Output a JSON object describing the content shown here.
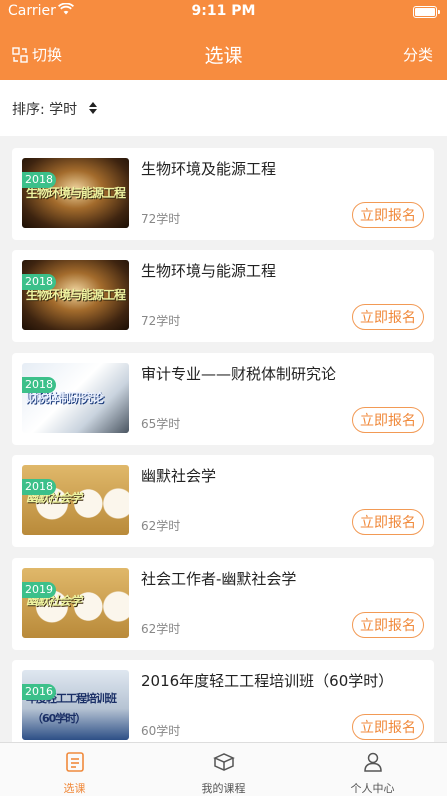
{
  "status_bar": {
    "carrier": "Carrier",
    "time": "9:11 PM"
  },
  "nav": {
    "switch_label": "切换",
    "title": "选课",
    "category_label": "分类"
  },
  "sort": {
    "label": "排序: 学时"
  },
  "colors": {
    "accent": "#f78c3f",
    "badge": "#3cc08a",
    "button_border": "#f29a55"
  },
  "courses": [
    {
      "title": "生物环境及能源工程",
      "hours": "72学时",
      "year": "2018",
      "thumb_text": "生物环境与能源工程",
      "button": "立即报名"
    },
    {
      "title": "生物环境与能源工程",
      "hours": "72学时",
      "year": "2018",
      "thumb_text": "生物环境与能源工程",
      "button": "立即报名"
    },
    {
      "title": "审计专业——财税体制研究论",
      "hours": "65学时",
      "year": "2018",
      "thumb_text": "财税体制研究论",
      "button": "立即报名"
    },
    {
      "title": "幽默社会学",
      "hours": "62学时",
      "year": "2018",
      "thumb_text": "幽默社会学",
      "button": "立即报名"
    },
    {
      "title": "社会工作者-幽默社会学",
      "hours": "62学时",
      "year": "2019",
      "thumb_text": "幽默社会学",
      "button": "立即报名"
    },
    {
      "title": "2016年度轻工工程培训班（60学时）",
      "hours": "60学时",
      "year": "2016",
      "thumb_text": "年度轻工工程培训班",
      "thumb_text2": "（60学时）",
      "button": "立即报名"
    }
  ],
  "tabs": [
    {
      "label": "选课",
      "icon": "course-select-icon"
    },
    {
      "label": "我的课程",
      "icon": "book-icon"
    },
    {
      "label": "个人中心",
      "icon": "user-icon"
    }
  ]
}
